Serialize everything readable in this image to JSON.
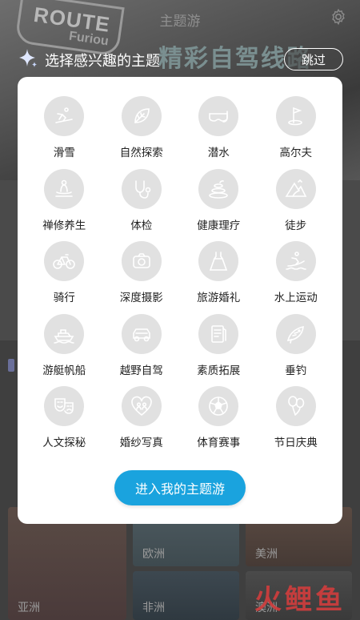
{
  "background": {
    "hero_title": "主题游",
    "sign_text": "ROUTE",
    "sign_sub": "Furiou",
    "banner_text": "精彩自驾线路",
    "cards": [
      {
        "label": "亚洲"
      },
      {
        "label": "欧洲"
      },
      {
        "label": "美洲"
      },
      {
        "label": "非洲"
      },
      {
        "label": "澳洲"
      }
    ],
    "watermark": "火鲤鱼"
  },
  "dialog": {
    "title": "选择感兴趣的主题",
    "skip_label": "跳过",
    "enter_label": "进入我的主题游",
    "accent_color": "#1aa3de"
  },
  "topics": [
    {
      "label": "滑雪",
      "icon": "skiing-icon"
    },
    {
      "label": "自然探索",
      "icon": "leaf-icon"
    },
    {
      "label": "潜水",
      "icon": "diving-mask-icon"
    },
    {
      "label": "高尔夫",
      "icon": "golf-flag-icon"
    },
    {
      "label": "禅修养生",
      "icon": "meditation-icon"
    },
    {
      "label": "体检",
      "icon": "stethoscope-icon"
    },
    {
      "label": "健康理疗",
      "icon": "spa-stones-icon"
    },
    {
      "label": "徒步",
      "icon": "mountain-icon"
    },
    {
      "label": "骑行",
      "icon": "bicycle-icon"
    },
    {
      "label": "深度摄影",
      "icon": "camera-icon"
    },
    {
      "label": "旅游婚礼",
      "icon": "wedding-dress-icon"
    },
    {
      "label": "水上运动",
      "icon": "surfing-icon"
    },
    {
      "label": "游艇帆船",
      "icon": "yacht-icon"
    },
    {
      "label": "越野自驾",
      "icon": "offroad-car-icon"
    },
    {
      "label": "素质拓展",
      "icon": "training-book-icon"
    },
    {
      "label": "垂钓",
      "icon": "fish-icon"
    },
    {
      "label": "人文探秘",
      "icon": "theater-masks-icon"
    },
    {
      "label": "婚纱写真",
      "icon": "couple-heart-icon"
    },
    {
      "label": "体育赛事",
      "icon": "soccer-ball-icon"
    },
    {
      "label": "节日庆典",
      "icon": "balloons-icon"
    }
  ]
}
